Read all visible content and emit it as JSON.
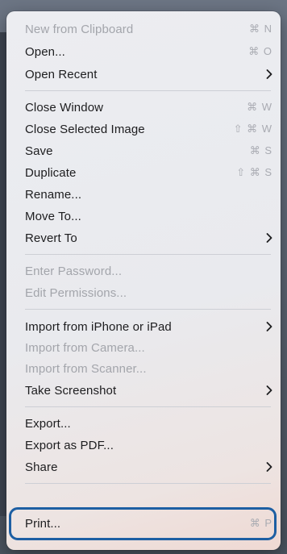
{
  "menu": {
    "items": [
      {
        "label": "New from Clipboard",
        "shortcut": "⌘ N",
        "disabled": true
      },
      {
        "label": "Open...",
        "shortcut": "⌘ O"
      },
      {
        "label": "Open Recent",
        "submenu": true
      },
      {
        "label": "Close Window",
        "shortcut": "⌘ W"
      },
      {
        "label": "Close Selected Image",
        "shortcut": "⇧ ⌘ W"
      },
      {
        "label": "Save",
        "shortcut": "⌘ S"
      },
      {
        "label": "Duplicate",
        "shortcut": "⇧ ⌘ S"
      },
      {
        "label": "Rename..."
      },
      {
        "label": "Move To..."
      },
      {
        "label": "Revert To",
        "submenu": true
      },
      {
        "label": "Enter Password...",
        "disabled": true
      },
      {
        "label": "Edit Permissions...",
        "disabled": true
      },
      {
        "label": "Import from iPhone or iPad",
        "submenu": true
      },
      {
        "label": "Import from Camera...",
        "disabled": true
      },
      {
        "label": "Import from Scanner...",
        "disabled": true
      },
      {
        "label": "Take Screenshot",
        "submenu": true
      },
      {
        "label": "Export..."
      },
      {
        "label": "Export as PDF..."
      },
      {
        "label": "Share",
        "submenu": true
      },
      {
        "label": "Print...",
        "shortcut": "⌘ P",
        "highlighted": true
      }
    ]
  },
  "colors": {
    "text": "#1d1d1f",
    "disabled_text": "#a3a5ab",
    "shortcut_text": "#a9abb2",
    "focus_ring": "#1d5fa3",
    "separator": "#cdcfd5"
  },
  "icons": {
    "submenu": "chevron-right-icon"
  }
}
